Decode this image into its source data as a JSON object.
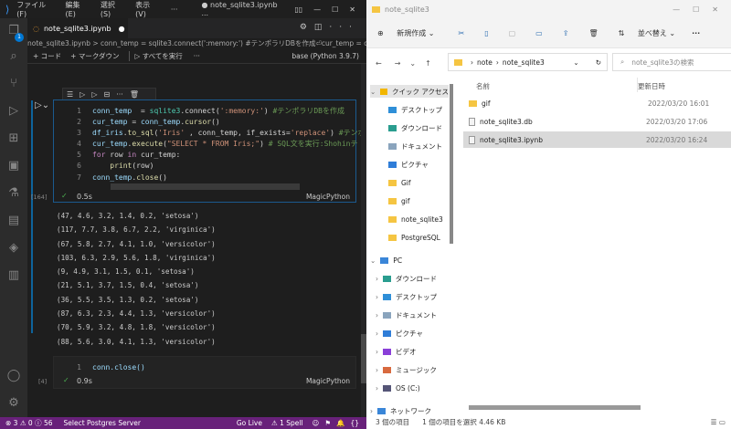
{
  "vscode": {
    "menu": [
      "ファイル(F)",
      "編集(E)",
      "選択(S)",
      "表示(V)",
      "···"
    ],
    "window_title": "● note_sqlite3.ipynb ...",
    "tab_label": "note_sqlite3.ipynb",
    "badge": "1",
    "breadcrumb": "note_sqlite3.ipynb > conn_temp = sqlite3.connect(':memory:') #テンポラリDBを作成⏎cur_temp = co...",
    "toolbar": {
      "code": "+ コード",
      "markdown": "+ マークダウン",
      "run_all": "▷ すべてを実行",
      "more": "···",
      "kernel": "base (Python 3.9.7)"
    },
    "cell1": {
      "lines": [
        {
          "n": "1",
          "parts": [
            [
              "var",
              "conn_temp"
            ],
            [
              "",
              "  = "
            ],
            [
              "mod",
              "sqlite3"
            ],
            [
              "",
              ".connect("
            ],
            [
              "st",
              "':memory:'"
            ],
            [
              "",
              ") "
            ],
            [
              "cm",
              "#テンポラリDBを作成"
            ]
          ]
        },
        {
          "n": "2",
          "parts": [
            [
              "var",
              "cur_temp"
            ],
            [
              "",
              " = "
            ],
            [
              "var",
              "conn_temp"
            ],
            [
              "",
              "."
            ],
            [
              "fn",
              "cursor"
            ],
            [
              "",
              "()"
            ]
          ]
        },
        {
          "n": "3",
          "parts": [
            [
              "var",
              "df_iris"
            ],
            [
              "",
              "."
            ],
            [
              "fn",
              "to_sql"
            ],
            [
              "",
              "("
            ],
            [
              "st",
              "'Iris'"
            ],
            [
              "",
              " , conn_temp, if_exists="
            ],
            [
              "st",
              "'replace'"
            ],
            [
              "",
              ") "
            ],
            [
              "cm",
              "#テンポ"
            ]
          ]
        },
        {
          "n": "4",
          "parts": [
            [
              "var",
              "cur_temp"
            ],
            [
              "",
              "."
            ],
            [
              "fn",
              "execute"
            ],
            [
              "",
              "("
            ],
            [
              "st",
              "\"SELECT * FROM Iris;\""
            ],
            [
              "",
              ") "
            ],
            [
              "cm",
              "# SQL文を実行:Shohinテ"
            ]
          ]
        },
        {
          "n": "5",
          "parts": [
            [
              "kw",
              "for"
            ],
            [
              "",
              " row "
            ],
            [
              "kw",
              "in"
            ],
            [
              "",
              " cur_temp:"
            ]
          ]
        },
        {
          "n": "6",
          "parts": [
            [
              "",
              "    "
            ],
            [
              "fn",
              "print"
            ],
            [
              "",
              "(row)"
            ]
          ]
        },
        {
          "n": "7",
          "parts": [
            [
              "var",
              "conn_temp"
            ],
            [
              "",
              "."
            ],
            [
              "fn",
              "close"
            ],
            [
              "",
              "()"
            ]
          ]
        }
      ],
      "exec_count": "[164]",
      "time": "0.5s",
      "language": "MagicPython"
    },
    "output": [
      "(47, 4.6, 3.2, 1.4, 0.2, 'setosa')",
      "(117, 7.7, 3.8, 6.7, 2.2, 'virginica')",
      "(67, 5.8, 2.7, 4.1, 1.0, 'versicolor')",
      "(103, 6.3, 2.9, 5.6, 1.8, 'virginica')",
      "(9, 4.9, 3.1, 1.5, 0.1, 'setosa')",
      "(21, 5.1, 3.7, 1.5, 0.4, 'setosa')",
      "(36, 5.5, 3.5, 1.3, 0.2, 'setosa')",
      "(87, 6.3, 2.3, 4.4, 1.3, 'versicolor')",
      "(70, 5.9, 3.2, 4.8, 1.8, 'versicolor')",
      "(88, 5.6, 3.0, 4.1, 1.3, 'versicolor')"
    ],
    "cell2": {
      "n": "1",
      "code": "conn.close()",
      "exec_count": "[4]",
      "time": "0.9s",
      "language": "MagicPython"
    },
    "status": {
      "problems": "⊗ 3 ⚠ 0 ⓘ 56",
      "server": "Select Postgres Server",
      "golive": "Go Live",
      "spell": "⚠ 1 Spell"
    }
  },
  "explorer": {
    "title": "note_sqlite3",
    "toolbar": {
      "new": "新規作成",
      "sort": "並べ替え",
      "more": "···"
    },
    "path": [
      "note",
      "note_sqlite3"
    ],
    "search_placeholder": "note_sqlite3の検索",
    "columns": {
      "name": "名前",
      "modified": "更新日時"
    },
    "files": [
      {
        "name": "gif",
        "date": "2022/03/20 16:01",
        "type": "folder"
      },
      {
        "name": "note_sqlite3.db",
        "date": "2022/03/20 17:06",
        "type": "file"
      },
      {
        "name": "note_sqlite3.ipynb",
        "date": "2022/03/20 16:24",
        "type": "file",
        "selected": true
      }
    ],
    "sidebar": {
      "quick": "クイック アクセス",
      "quick_items": [
        "デスクトップ",
        "ダウンロード",
        "ドキュメント",
        "ピクチャ",
        "Gif",
        "gif",
        "note_sqlite3",
        "PostgreSQL"
      ],
      "pc": "PC",
      "pc_items": [
        "ダウンロード",
        "デスクトップ",
        "ドキュメント",
        "ピクチャ",
        "ビデオ",
        "ミュージック",
        "OS (C:)"
      ],
      "network": "ネットワーク"
    },
    "status": {
      "count": "3 個の項目",
      "selected": "1 個の項目を選択  4.46 KB"
    }
  }
}
